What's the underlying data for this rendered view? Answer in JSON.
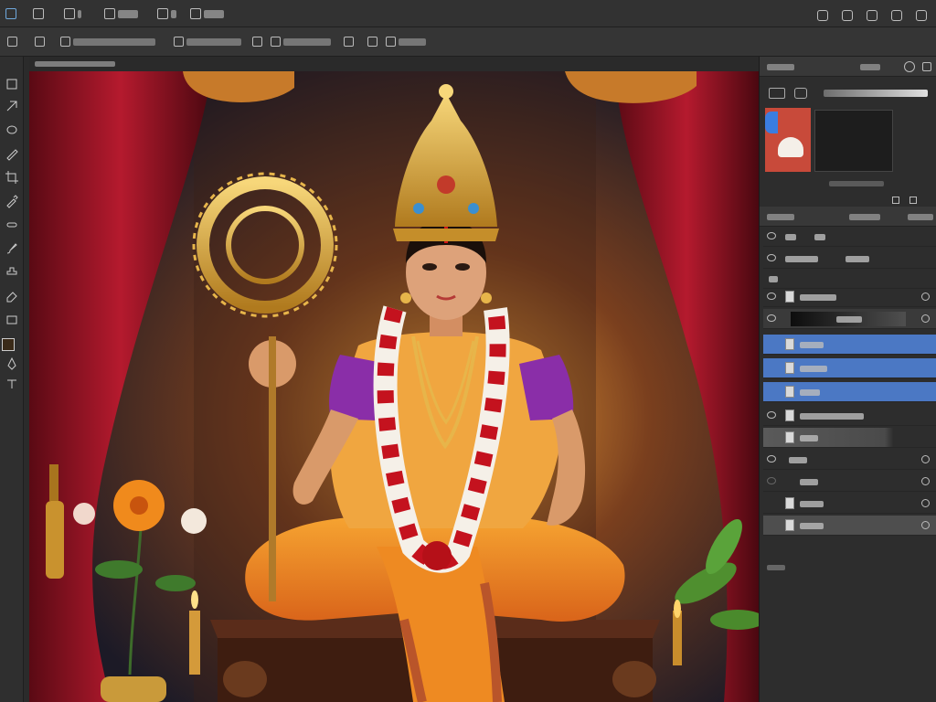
{
  "app": {
    "menu": {
      "items": [
        "",
        "",
        "",
        "",
        "",
        ""
      ]
    },
    "options_bar": {
      "items": [
        "",
        "",
        "",
        "",
        "",
        "",
        ""
      ]
    },
    "document": {
      "tab_label": ""
    },
    "panels": {
      "color_header": {
        "tab_1": "",
        "tab_2": ""
      },
      "layers_header": {
        "tab_1": "",
        "tab_2": "",
        "tab_3": ""
      },
      "layers": [
        {
          "name": "",
          "selected": false
        },
        {
          "name": "",
          "selected": false
        },
        {
          "name": "",
          "selected": false
        },
        {
          "name": "",
          "selected": true
        },
        {
          "name": "",
          "selected": true
        },
        {
          "name": "",
          "selected": true
        },
        {
          "name": "",
          "selected": false
        },
        {
          "name": "",
          "selected": false
        },
        {
          "name": "",
          "selected": false
        },
        {
          "name": "",
          "selected": false
        },
        {
          "name": "",
          "selected": false
        },
        {
          "name": "",
          "selected": false
        },
        {
          "name": "",
          "selected": false
        }
      ]
    },
    "colors": {
      "accent": "#4b78c4",
      "panel": "#2d2d2d",
      "foreground_swatch": "#c84a3a"
    }
  }
}
